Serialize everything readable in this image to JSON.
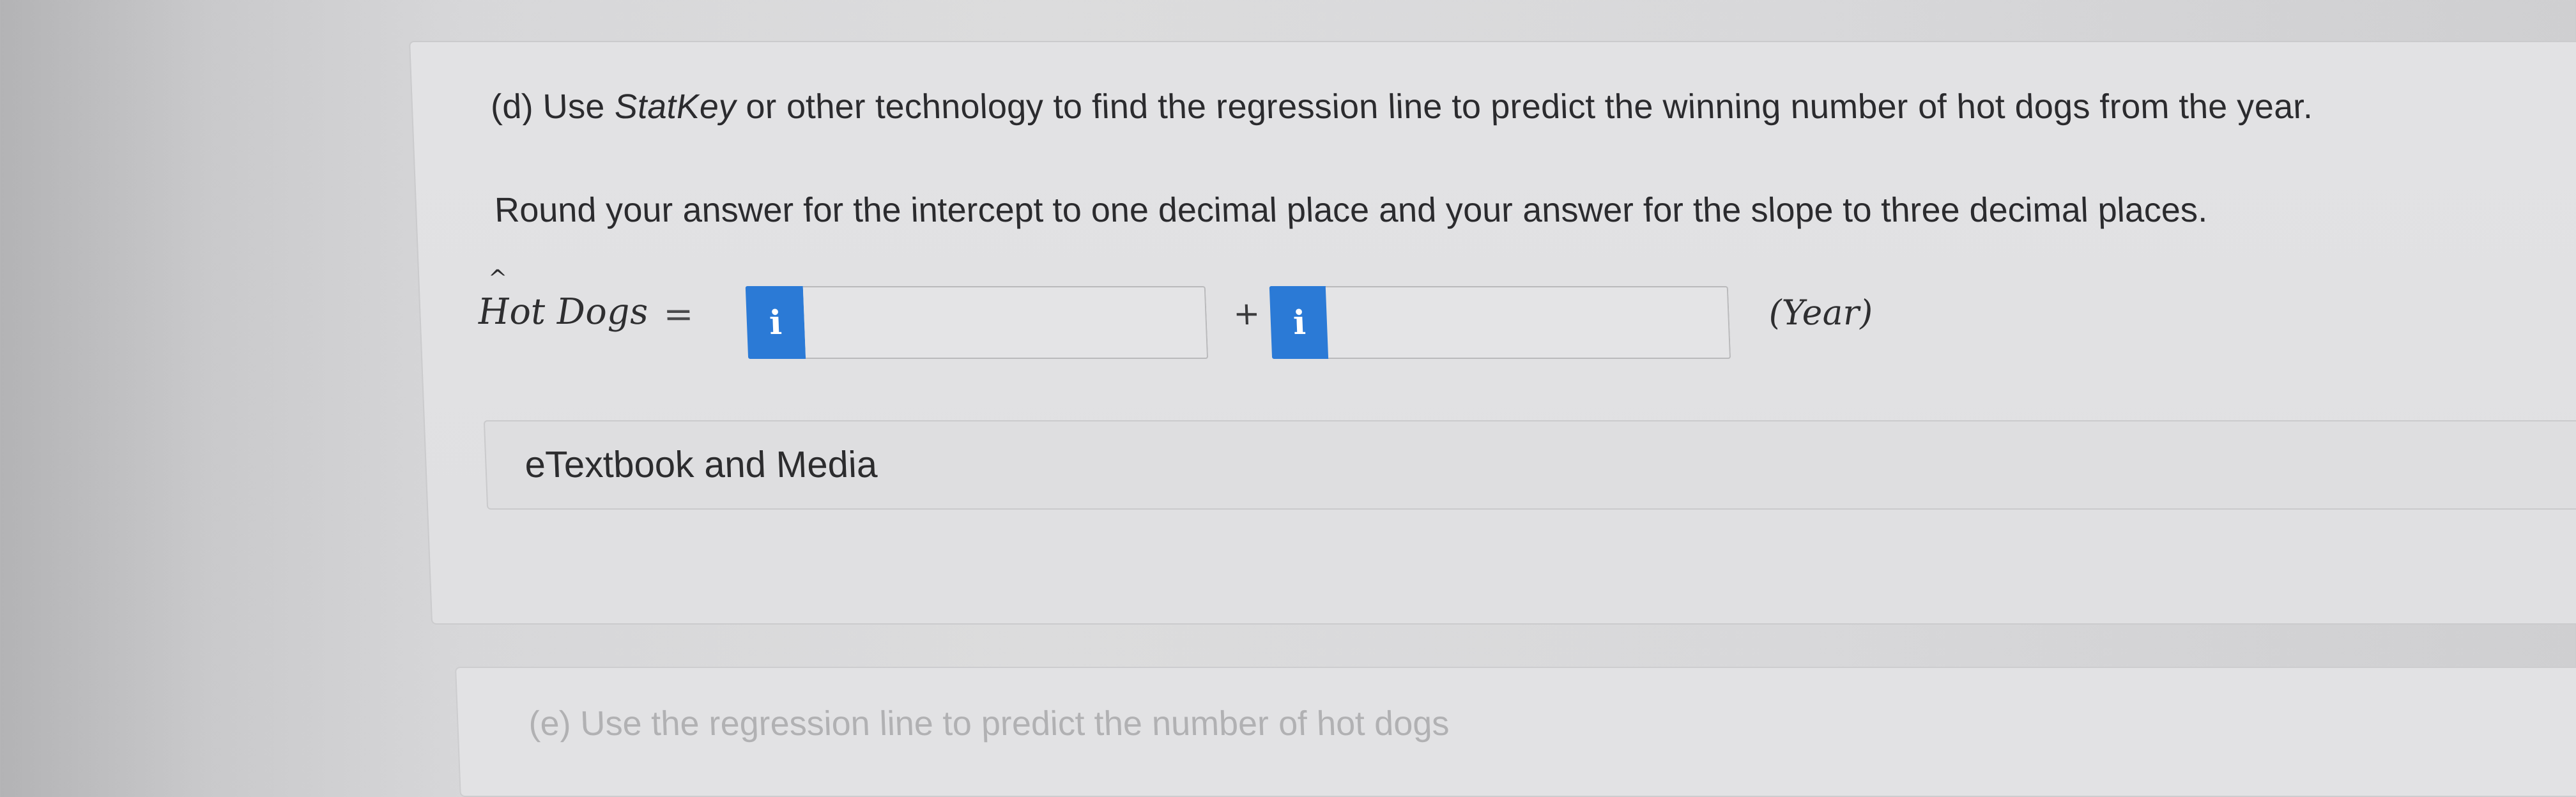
{
  "question": {
    "part_label": "(d)",
    "prompt_before": "Use ",
    "prompt_tool": "StatKey",
    "prompt_after": " or other technology to find the regression line to predict the winning number of hot dogs from the year.",
    "rounding_instructions": "Round your answer for the intercept to one decimal place and your answer for the slope to three decimal places."
  },
  "equation": {
    "response_variable": "Hot Dogs",
    "hat_symbol": "^",
    "equals_sign": "=",
    "info_badge_label": "i",
    "plus_sign": "+",
    "explanatory_variable": "(Year)",
    "intercept_value": "",
    "slope_value": ""
  },
  "media": {
    "label": "eTextbook and Media"
  },
  "next_question": {
    "partial_text": "(e) Use the regression line to predict the number of hot dogs"
  }
}
